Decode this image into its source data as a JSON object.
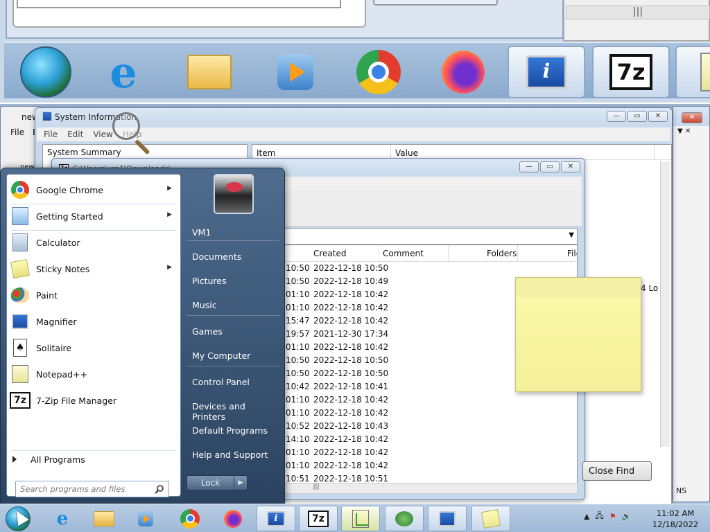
{
  "magnified_view": {
    "icons": [
      "start-orb",
      "ie-icon",
      "explorer-folder-icon",
      "media-player-icon",
      "chrome-icon",
      "firefox-icon",
      "system-info-icon",
      "7zip-icon",
      "notepadpp-icon"
    ]
  },
  "sysinfo_window": {
    "title": "System Information",
    "menu": [
      "File",
      "Edit",
      "View",
      "Help"
    ],
    "left_header": "System Summary",
    "col_item": "Item",
    "col_value": "Value",
    "partial_text": "4 Lo"
  },
  "notepad_window": {
    "title_fragment": "new",
    "menu_file": "File",
    "menu_e": "E",
    "tab_fragment": "new"
  },
  "zip_window": {
    "path": "C:\\Users\\vm1\\Downloads\\",
    "columns": {
      "created": "Created",
      "comment": "Comment",
      "folders": "Folders",
      "files": "File"
    },
    "rows": [
      {
        "modified": "10:50",
        "created": "2022-12-18 10:50"
      },
      {
        "modified": "10:50",
        "created": "2022-12-18 10:49"
      },
      {
        "modified": "01:10",
        "created": "2022-12-18 10:42"
      },
      {
        "modified": "01:10",
        "created": "2022-12-18 10:42"
      },
      {
        "modified": "15:47",
        "created": "2022-12-18 10:42"
      },
      {
        "modified": "19:57",
        "created": "2021-12-30 17:34"
      },
      {
        "modified": "01:10",
        "created": "2022-12-18 10:42"
      },
      {
        "modified": "10:50",
        "created": "2022-12-18 10:50"
      },
      {
        "modified": "10:50",
        "created": "2022-12-18 10:50"
      },
      {
        "modified": "10:42",
        "created": "2022-12-18 10:41"
      },
      {
        "modified": "01:10",
        "created": "2022-12-18 10:42"
      },
      {
        "modified": "01:10",
        "created": "2022-12-18 10:42"
      },
      {
        "modified": "10:52",
        "created": "2022-12-18 10:43"
      },
      {
        "modified": "14:10",
        "created": "2022-12-18 10:42"
      },
      {
        "modified": "01:10",
        "created": "2022-12-18 10:42"
      },
      {
        "modified": "01:10",
        "created": "2022-12-18 10:42"
      },
      {
        "modified": "10:51",
        "created": "2022-12-18 10:51"
      }
    ]
  },
  "find_dialog": {
    "close_find": "Close Find",
    "ns_label": "NS"
  },
  "start_menu": {
    "programs": [
      {
        "label": "Google Chrome",
        "icon": "chrome-icon",
        "has_submenu": true
      },
      {
        "label": "Getting Started",
        "icon": "getting-started-icon",
        "has_submenu": true
      },
      {
        "label": "Calculator",
        "icon": "calculator-icon",
        "has_submenu": false
      },
      {
        "label": "Sticky Notes",
        "icon": "sticky-notes-icon",
        "has_submenu": true
      },
      {
        "label": "Paint",
        "icon": "paint-icon",
        "has_submenu": false
      },
      {
        "label": "Magnifier",
        "icon": "magnifier-icon",
        "has_submenu": false
      },
      {
        "label": "Solitaire",
        "icon": "solitaire-icon",
        "has_submenu": false
      },
      {
        "label": "Notepad++",
        "icon": "notepadpp-icon",
        "has_submenu": false
      },
      {
        "label": "7-Zip File Manager",
        "icon": "7zip-icon",
        "has_submenu": false
      }
    ],
    "all_programs": "All Programs",
    "search_placeholder": "Search programs and files",
    "right_items": [
      "VM1",
      "Documents",
      "Pictures",
      "Music",
      "Games",
      "My Computer",
      "Control Panel",
      "Devices and Printers",
      "Default Programs",
      "Help and Support"
    ],
    "lock_label": "Lock"
  },
  "taskbar": {
    "pinned": [
      "ie-icon",
      "explorer-folder-icon",
      "media-player-icon",
      "chrome-icon",
      "firefox-icon"
    ],
    "open_apps": [
      "system-info-icon",
      "7zip-icon",
      "notepadpp-icon",
      "frog-icon",
      "magnifier-icon",
      "sticky-notes-icon"
    ],
    "clock_time": "11:02 AM",
    "clock_date": "12/18/2022"
  }
}
